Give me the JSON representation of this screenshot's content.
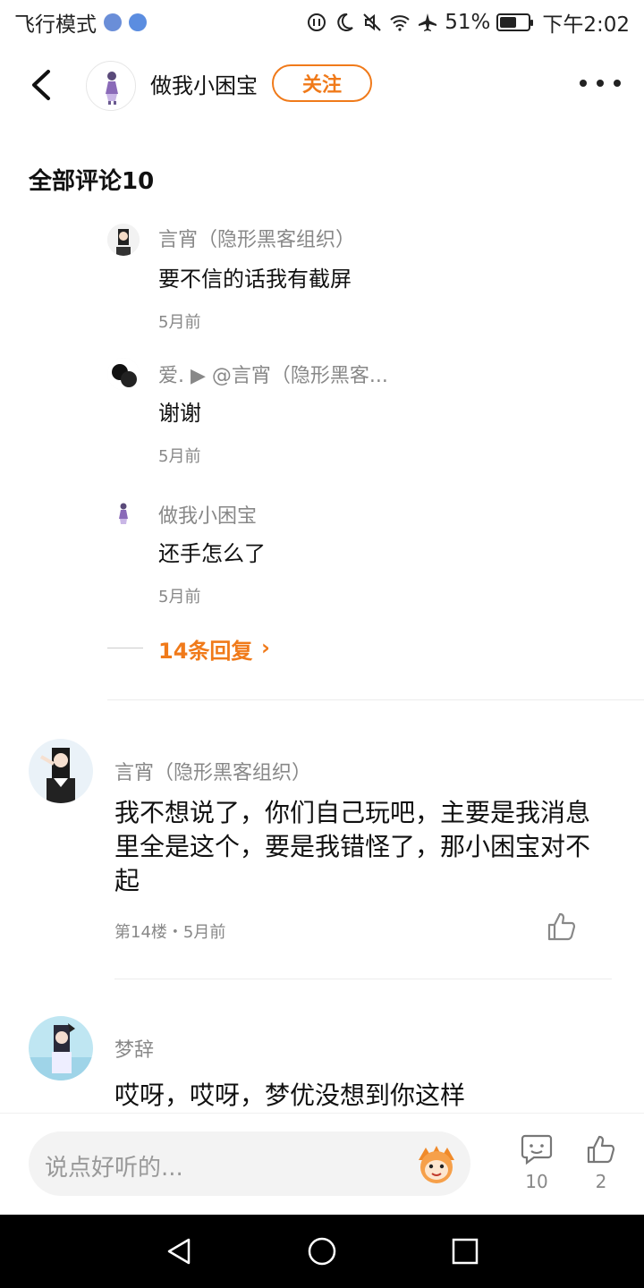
{
  "status_bar": {
    "left_text": "飞行模式",
    "battery_text": "51%",
    "battery_level": 0.51,
    "time": "下午2:02"
  },
  "header": {
    "user_name": "做我小困宝",
    "follow_label": "关注"
  },
  "comments_section": {
    "title": "全部评论10"
  },
  "replies": [
    {
      "author": "言宵（隐形黑客组织）",
      "text": "要不信的话我有截屏",
      "time": "5月前"
    },
    {
      "author": "爱. ▶ @言宵（隐形黑客...",
      "text": "谢谢",
      "time": "5月前"
    },
    {
      "author": "做我小困宝",
      "text": "还手怎么了",
      "time": "5月前"
    }
  ],
  "more_replies_label": "14条回复",
  "comments": [
    {
      "author": "言宵（隐形黑客组织）",
      "text": "我不想说了，你们自己玩吧，主要是我消息里全是这个，要是我错怪了，那小困宝对不起",
      "meta": "第14楼・5月前"
    },
    {
      "author": "梦辞",
      "text": "哎呀，哎呀，梦优没想到你这样",
      "meta": ""
    }
  ],
  "input_bar": {
    "placeholder": "说点好听的...",
    "comment_count": "10",
    "like_count": "2"
  },
  "colors": {
    "accent": "#f07a1a",
    "text_primary": "#111111",
    "text_secondary": "#888888",
    "nav_bg": "#000000"
  }
}
